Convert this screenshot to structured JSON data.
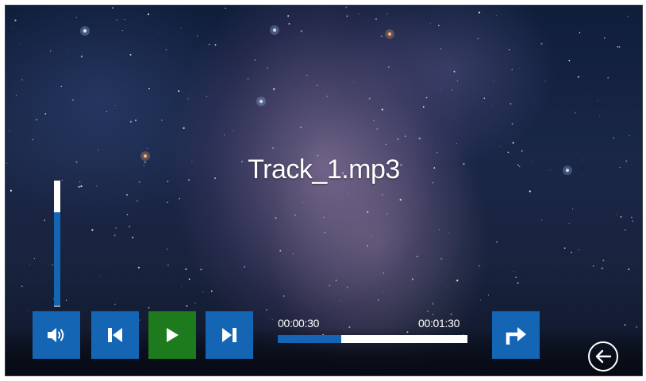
{
  "player": {
    "track_title": "Track_1.mp3",
    "current_time": "00:00:30",
    "total_time": "00:01:30",
    "progress_fraction": 0.333,
    "volume_fraction": 0.75
  },
  "controls": {
    "volume": "speaker-icon",
    "previous": "skip-previous-icon",
    "play": "play-icon",
    "next": "skip-next-icon",
    "share": "forward-arrow-icon",
    "back": "back-arrow-circle-icon"
  },
  "colors": {
    "accent_blue": "#1565b5",
    "play_green": "#1d7a1d",
    "text": "#ffffff"
  }
}
